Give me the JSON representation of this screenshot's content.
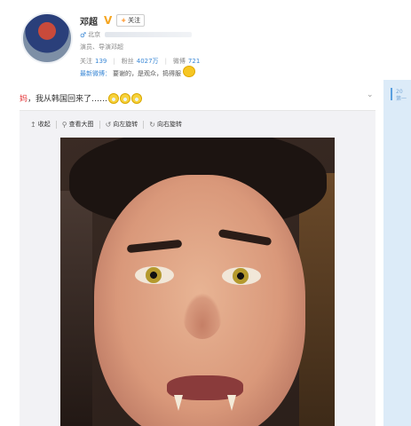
{
  "profile": {
    "name": "邓超",
    "verified_icon": "verified-v-icon",
    "follow_label": "关注",
    "gender_icon": "male-icon",
    "location": "北京",
    "description": "演员、导演邓超",
    "stats": [
      {
        "label": "关注",
        "value": "139"
      },
      {
        "label": "粉丝",
        "value": "4027万"
      },
      {
        "label": "微博",
        "value": "721"
      }
    ],
    "latest_label": "最新微博：",
    "latest_text": "要谢的，是观众，捣得服"
  },
  "post": {
    "text_prefix": "妈",
    "text_body": "，我从韩国回来了……",
    "emoji_icon": "crying-laughing-emoji",
    "expand_icon": "chevron-down-icon"
  },
  "toolbar": {
    "collapse_label": "收起",
    "view_large_label": "查看大图",
    "rotate_left_label": "向左旋转",
    "rotate_right_label": "向右旋转"
  },
  "sidebar": {
    "line1": "20",
    "line2": "第一"
  },
  "colors": {
    "link_blue": "#3b88d6",
    "accent_orange": "#ff8200",
    "highlight_red": "#e4393c",
    "verified_gold": "#f5a623"
  }
}
